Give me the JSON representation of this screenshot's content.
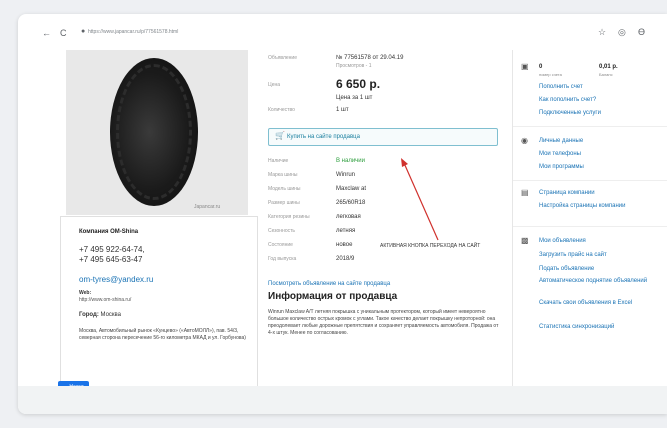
{
  "toolbar": {
    "back": "←",
    "reload": "C",
    "lock": "🔒",
    "url": "https://www.japancar.ru/p/77561578.html",
    "star": "☆",
    "extension": "◎",
    "profile": "ϴ"
  },
  "product": {
    "photo_caption": "Japancar.ru",
    "listing_label": "Объявление",
    "listing_value": "№ 77561578 от 29.04.19",
    "views": "Просмотров - 1",
    "price_label": "Цена",
    "price": "6 650 р.",
    "price_note": "Цена за 1 шт",
    "qty_label": "Количество",
    "qty_value": "1 шт",
    "buy_button": "Купить на сайте продавца",
    "fields": [
      {
        "label": "Наличие",
        "value": "В наличии"
      },
      {
        "label": "Марка шины",
        "value": "Winrun"
      },
      {
        "label": "Модель шины",
        "value": "Maxclaw at"
      },
      {
        "label": "Размер шины",
        "value": "265/60R18"
      },
      {
        "label": "Категория резины",
        "value": "легковая"
      },
      {
        "label": "Сезонность",
        "value": "летняя"
      },
      {
        "label": "Состояние",
        "value": "новое"
      },
      {
        "label": "Год выпуска",
        "value": "2018/9"
      }
    ],
    "see_link": "Посмотреть объявление на сайте продавца",
    "info_title": "Информация от продавца",
    "info_text": "Winrun Maxclaw A/T летняя покрышка с уникальным протектором, который имеет невероятно большое количество острых кромок с углами. Такое качество делает покрышку непроторной: она преодолевает любые дорожные препятствия и сохраняет управляемость автомобиля. Продажа от 4-х штук. Менее по согласованию."
  },
  "annotation": "АКТИВНАЯ КНОПКА ПЕРЕХОДА НА САЙТ",
  "company": {
    "title": "Компания OM-Shina",
    "phone1": "+7 495 922-64-74,",
    "phone2": "+7 495 645-63-47",
    "email": "om-tyres@yandex.ru",
    "web_label": "Web:",
    "web_value": "http://www.om-shina.ru/",
    "city_label": "Город:",
    "city_value": "Москва",
    "address": "Москва, Автомобильный рынок «Кунцево» («АвтоМОЛЛ»), пав. 54/3, северная сторона пересечение 56-го километра МКАД и ул. Горбунова)"
  },
  "back_button": "← Назад",
  "sidebar": {
    "balance_value": "0",
    "balance_label": "номер счета",
    "sum_value": "0,01 р.",
    "sum_label": "Баланс",
    "account_links": [
      "Пополнить счет",
      "Как пополнить счет?",
      "Подключенные услуги"
    ],
    "personal_links": [
      "Личные данные",
      "Мои телефоны",
      "Мои программы"
    ],
    "company_links": [
      "Страница компании",
      "Настройка страницы компании"
    ],
    "ads_links": [
      "Мои объявления",
      "Загрузить прайс на сайт",
      "Подать объявление",
      "Автоматическое поднятие объявлений",
      "Скачать свои объявления в Excel",
      "Статистика синхронизаций"
    ]
  }
}
